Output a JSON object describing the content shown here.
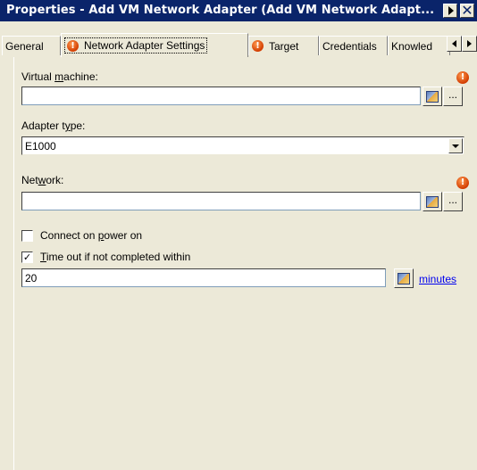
{
  "window": {
    "title": "Properties - Add VM Network Adapter (Add VM Network Adapt...",
    "pin_icon": "pin-arrow-icon",
    "close_icon": "close-icon"
  },
  "tabs": [
    {
      "label": "General",
      "alert": false,
      "active": false
    },
    {
      "label": "Network Adapter Settings",
      "alert": true,
      "active": true
    },
    {
      "label": "Target",
      "alert": true,
      "active": false
    },
    {
      "label": "Credentials",
      "alert": false,
      "active": false
    },
    {
      "label": "Knowled",
      "alert": false,
      "active": false
    }
  ],
  "form": {
    "vm_label_pre": "Virtual ",
    "vm_label_key": "m",
    "vm_label_post": "achine:",
    "vm_value": "",
    "adapter_label_pre": "Adapter t",
    "adapter_label_key": "y",
    "adapter_label_post": "pe:",
    "adapter_value": "E1000",
    "network_label_pre": "Net",
    "network_label_key": "w",
    "network_label_post": "ork:",
    "network_value": "",
    "connect_label_pre": "Connect on ",
    "connect_label_key": "p",
    "connect_label_post": "ower on",
    "connect_checked": false,
    "timeout_label_key": "T",
    "timeout_label_post": "ime out if not completed within",
    "timeout_checked": true,
    "timeout_value": "20",
    "timeout_unit": "minutes",
    "ellipsis": "...",
    "check_mark": "✓",
    "alert_glyph": "!"
  },
  "colors": {
    "title_bar": "#0a246a",
    "dialog_bg": "#ece9d8",
    "alert": "#d23c00",
    "link": "#0000ee"
  }
}
